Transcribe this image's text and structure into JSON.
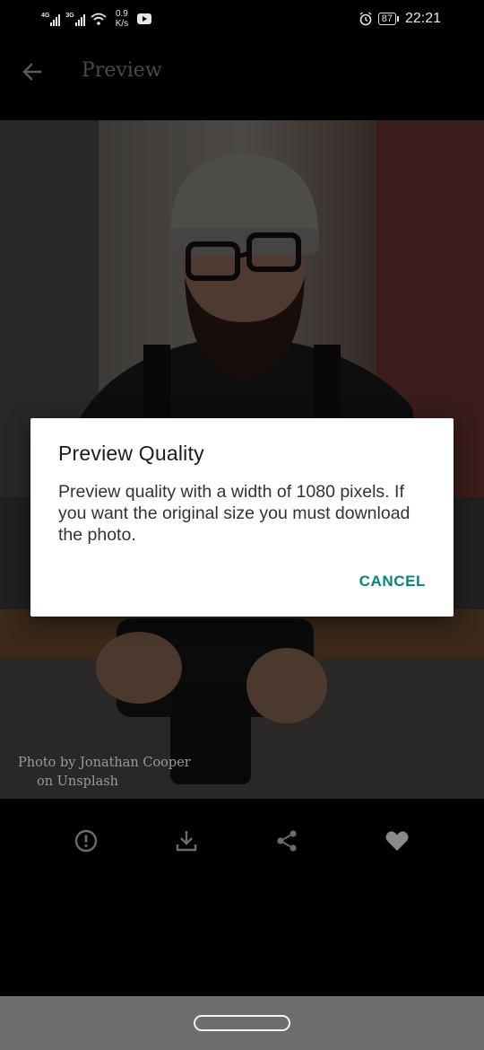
{
  "status_bar": {
    "network1": "4G",
    "network2": "3G",
    "speed_value": "0.9",
    "speed_unit": "K/s",
    "battery": "87",
    "time": "22:21",
    "icons": [
      "signal-icon",
      "wifi-icon",
      "youtube-icon",
      "alarm-icon",
      "battery-icon"
    ]
  },
  "app_bar": {
    "title": "Preview",
    "back_icon": "arrow-left-icon"
  },
  "photo": {
    "credit_line1": "Photo by Jonathan Cooper",
    "credit_line2": "on Unsplash"
  },
  "actions": [
    {
      "icon": "info-icon"
    },
    {
      "icon": "download-icon"
    },
    {
      "icon": "share-icon"
    },
    {
      "icon": "heart-icon"
    }
  ],
  "dialog": {
    "title": "Preview Quality",
    "body": "Preview quality with a width of 1080 pixels. If you want the original size you must download the photo.",
    "cancel_label": "CANCEL"
  },
  "colors": {
    "accent": "#00897b",
    "background": "#000000",
    "nav_bar": "#6e6e6e"
  }
}
